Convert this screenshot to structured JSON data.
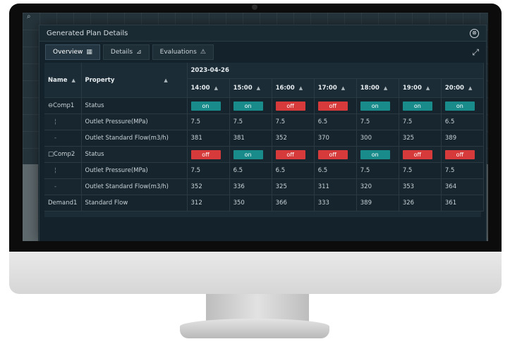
{
  "modal": {
    "title": "Generated Plan Details",
    "close_glyph": "⊗",
    "expand_glyph": "⤢"
  },
  "tabs": [
    {
      "label": "Overview",
      "icon": "table-icon",
      "glyph": "▦",
      "active": true
    },
    {
      "label": "Details",
      "icon": "chart-icon",
      "glyph": "⊿",
      "active": false
    },
    {
      "label": "Evaluations",
      "icon": "warning-icon",
      "glyph": "⚠",
      "active": false
    }
  ],
  "table": {
    "name_header": "Name",
    "property_header": "Property",
    "date_header": "2023-04-26",
    "sort_glyph": "▲",
    "times": [
      "14:00",
      "15:00",
      "16:00",
      "17:00",
      "18:00",
      "19:00",
      "20:00"
    ],
    "rows": [
      {
        "name": "⊖Comp1",
        "property": "Status",
        "type": "status",
        "values": [
          "on",
          "on",
          "off",
          "off",
          "on",
          "on",
          "on"
        ]
      },
      {
        "name": "¦",
        "property": "Outlet Pressure(MPa)",
        "type": "value",
        "values": [
          "7.5",
          "7.5",
          "7.5",
          "6.5",
          "7.5",
          "7.5",
          "6.5"
        ]
      },
      {
        "name": "-",
        "property": "Outlet Standard Flow(m3/h)",
        "type": "value",
        "values": [
          "381",
          "381",
          "352",
          "370",
          "300",
          "325",
          "389"
        ]
      },
      {
        "name": "□Comp2",
        "property": "Status",
        "type": "status",
        "values": [
          "off",
          "on",
          "off",
          "off",
          "on",
          "off",
          "off"
        ]
      },
      {
        "name": "¦",
        "property": "Outlet Pressure(MPa)",
        "type": "value",
        "values": [
          "7.5",
          "6.5",
          "6.5",
          "6.5",
          "7.5",
          "7.5",
          "7.5"
        ]
      },
      {
        "name": "-",
        "property": "Outlet Standard Flow(m3/h)",
        "type": "value",
        "values": [
          "352",
          "336",
          "325",
          "311",
          "320",
          "353",
          "364"
        ]
      },
      {
        "name": "Demand1",
        "property": "Standard Flow",
        "type": "value",
        "values": [
          "312",
          "350",
          "366",
          "333",
          "389",
          "326",
          "361"
        ]
      }
    ]
  },
  "colors": {
    "on": "#1a8b8b",
    "off": "#d63a3a",
    "background": "#14222b"
  }
}
